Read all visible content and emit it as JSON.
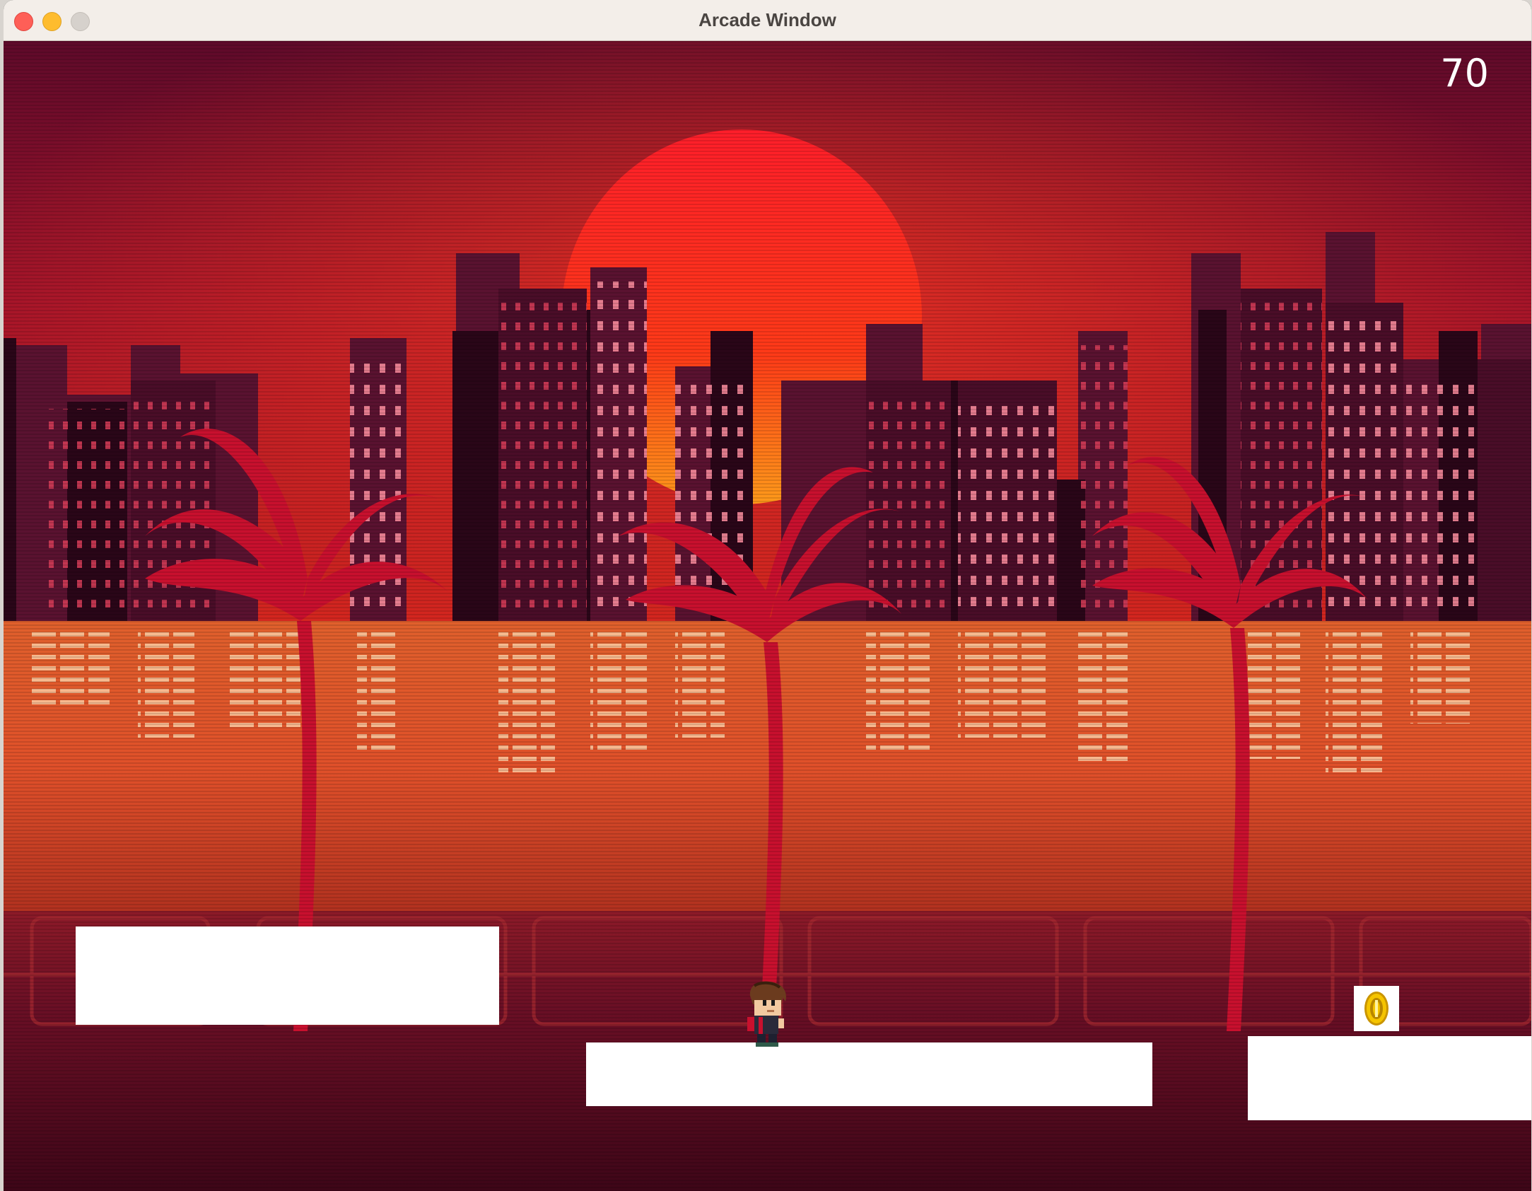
{
  "window": {
    "title": "Arcade Window"
  },
  "hud": {
    "score": "70"
  },
  "scene": {
    "background": "retro synthwave city skyline at sunset with palm trees and water reflection",
    "colors": {
      "sky_top": "#6b0a2a",
      "sky_mid": "#c8102e",
      "sun": "#ff2a1a",
      "sun_low": "#ff8a1a",
      "water": "#e0502a",
      "ground": "#5a0a22",
      "platform": "#ffffff",
      "coin": "#f5c400"
    }
  },
  "objects": {
    "platform_count": 3,
    "coin": "gold-coin-icon",
    "player": "player-character"
  }
}
